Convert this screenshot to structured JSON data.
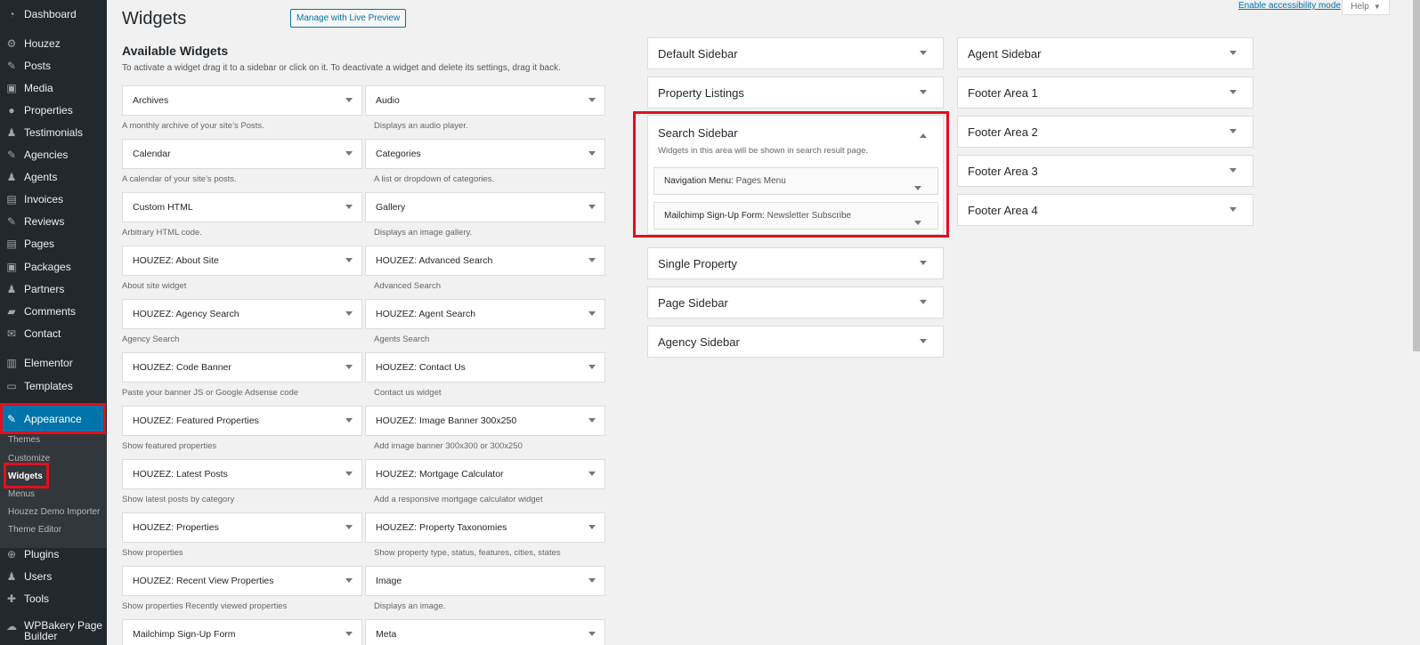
{
  "menu": {
    "items": [
      {
        "label": "Dashboard",
        "icon": "dashboard-icon"
      },
      {
        "label": "Houzez",
        "icon": "gear-icon"
      },
      {
        "label": "Posts",
        "icon": "pin-icon"
      },
      {
        "label": "Media",
        "icon": "media-icon"
      },
      {
        "label": "Properties",
        "icon": "location-icon"
      },
      {
        "label": "Testimonials",
        "icon": "people-icon"
      },
      {
        "label": "Agencies",
        "icon": "pin-icon"
      },
      {
        "label": "Agents",
        "icon": "people-icon"
      },
      {
        "label": "Invoices",
        "icon": "page-icon"
      },
      {
        "label": "Reviews",
        "icon": "pin-icon"
      },
      {
        "label": "Pages",
        "icon": "page-icon"
      },
      {
        "label": "Packages",
        "icon": "media-icon"
      },
      {
        "label": "Partners",
        "icon": "people-icon"
      },
      {
        "label": "Comments",
        "icon": "comment-icon"
      },
      {
        "label": "Contact",
        "icon": "mail-icon"
      },
      {
        "label": "Elementor",
        "icon": "elementor-icon"
      },
      {
        "label": "Templates",
        "icon": "folder-icon"
      },
      {
        "label": "Appearance",
        "icon": "brush-icon"
      },
      {
        "label": "Plugins",
        "icon": "plugin-icon"
      },
      {
        "label": "Users",
        "icon": "user-icon"
      },
      {
        "label": "Tools",
        "icon": "wrench-icon"
      },
      {
        "label": "WPBakery Page Builder",
        "icon": "wpbakery-icon"
      }
    ],
    "submenu": [
      "Themes",
      "Customize",
      "Widgets",
      "Menus",
      "Houzez Demo Importer",
      "Theme Editor"
    ]
  },
  "header": {
    "title": "Widgets",
    "live_preview": "Manage with Live Preview",
    "accessibility": "Enable accessibility mode",
    "help": "Help"
  },
  "available": {
    "title": "Available Widgets",
    "description": "To activate a widget drag it to a sidebar or click on it. To deactivate a widget and delete its settings, drag it back.",
    "left": [
      {
        "title": "Archives",
        "desc": "A monthly archive of your site’s Posts."
      },
      {
        "title": "Calendar",
        "desc": "A calendar of your site’s posts."
      },
      {
        "title": "Custom HTML",
        "desc": "Arbitrary HTML code."
      },
      {
        "title": "HOUZEZ: About Site",
        "desc": "About site widget"
      },
      {
        "title": "HOUZEZ: Agency Search",
        "desc": "Agency Search"
      },
      {
        "title": "HOUZEZ: Code Banner",
        "desc": "Paste your banner JS or Google Adsense code"
      },
      {
        "title": "HOUZEZ: Featured Properties",
        "desc": "Show featured properties"
      },
      {
        "title": "HOUZEZ: Latest Posts",
        "desc": "Show latest posts by category"
      },
      {
        "title": "HOUZEZ: Properties",
        "desc": "Show properties"
      },
      {
        "title": "HOUZEZ: Recent View Properties",
        "desc": "Show properties Recently viewed properties"
      },
      {
        "title": "Mailchimp Sign-Up Form",
        "desc": ""
      }
    ],
    "right": [
      {
        "title": "Audio",
        "desc": "Displays an audio player."
      },
      {
        "title": "Categories",
        "desc": "A list or dropdown of categories."
      },
      {
        "title": "Gallery",
        "desc": "Displays an image gallery."
      },
      {
        "title": "HOUZEZ: Advanced Search",
        "desc": "Advanced Search"
      },
      {
        "title": "HOUZEZ: Agent Search",
        "desc": "Agents Search"
      },
      {
        "title": "HOUZEZ: Contact Us",
        "desc": "Contact us widget"
      },
      {
        "title": "HOUZEZ: Image Banner 300x250",
        "desc": "Add image banner 300x300 or 300x250"
      },
      {
        "title": "HOUZEZ: Mortgage Calculator",
        "desc": "Add a responsive mortgage calculator widget"
      },
      {
        "title": "HOUZEZ: Property Taxonomies",
        "desc": "Show property type, status, features, cities, states"
      },
      {
        "title": "Image",
        "desc": "Displays an image."
      },
      {
        "title": "Meta",
        "desc": ""
      }
    ]
  },
  "sidebars": {
    "col1_top": [
      "Default Sidebar",
      "Property Listings"
    ],
    "search": {
      "title": "Search Sidebar",
      "desc": "Widgets in this area will be shown in search result page.",
      "widgets": [
        {
          "name": "Navigation Menu:",
          "title": "Pages Menu"
        },
        {
          "name": "Mailchimp Sign-Up Form:",
          "title": "Newsletter Subscribe"
        }
      ]
    },
    "col1_bottom": [
      "Single Property",
      "Page Sidebar",
      "Agency Sidebar"
    ],
    "col2": [
      "Agent Sidebar",
      "Footer Area 1",
      "Footer Area 2",
      "Footer Area 3",
      "Footer Area 4"
    ]
  },
  "colors": {
    "admin_bg": "#23282d",
    "accent": "#0073aa",
    "highlight": "#e0101c"
  }
}
